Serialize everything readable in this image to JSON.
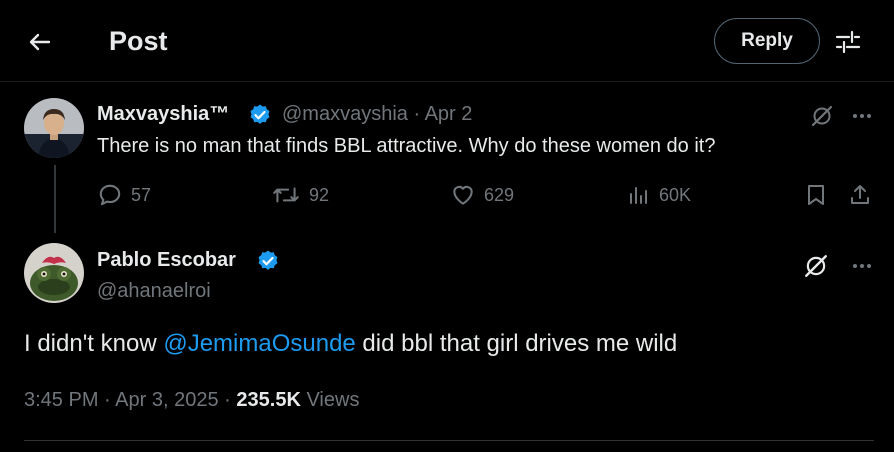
{
  "header": {
    "title": "Post",
    "reply_label": "Reply",
    "back_icon": "arrow-left-icon",
    "settings_icon": "sliders-icon"
  },
  "quoted_tweet": {
    "name": "Maxvayshia™",
    "handle": "@maxvayshia",
    "separator": "·",
    "date": "Apr 2",
    "text": "There is no man that finds BBL attractive. Why do these women do it?",
    "stats": {
      "replies": "57",
      "reposts": "92",
      "likes": "629",
      "views": "60K"
    }
  },
  "main_tweet": {
    "name": "Pablo Escobar",
    "handle": "@ahanaelroi",
    "text_before": "I didn't know ",
    "mention": "@JemimaOsunde",
    "text_after": " did bbl that girl drives me wild",
    "time": "3:45 PM",
    "separator": "·",
    "date": "Apr 3, 2025",
    "separator2": "·",
    "views_count": "235.5K",
    "views_label": "Views"
  },
  "colors": {
    "background": "#000000",
    "text": "#e7e9ea",
    "muted": "#71767b",
    "accent": "#1d9bf0"
  }
}
